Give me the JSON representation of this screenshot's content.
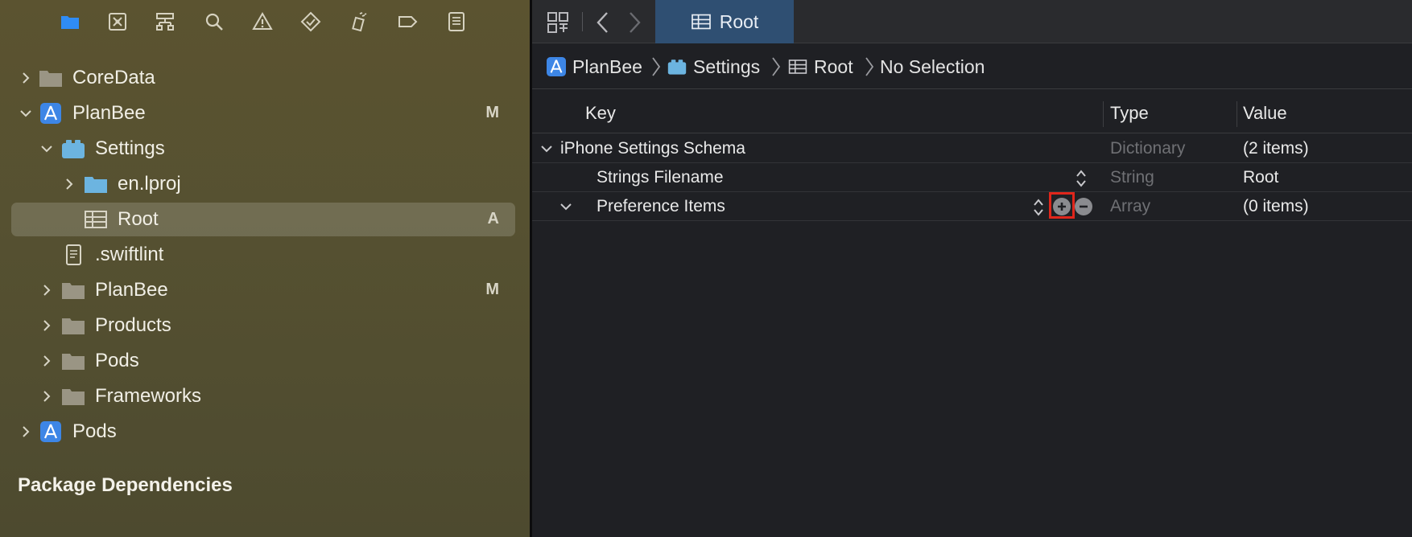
{
  "navigator": {
    "toolbar_icons": [
      "folder-icon",
      "source-control-icon",
      "hierarchy-icon",
      "search-icon",
      "warning-icon",
      "test-icon",
      "debug-icon",
      "breakpoint-icon",
      "report-icon"
    ],
    "tree": [
      {
        "label": "CoreData",
        "icon": "folder-icon",
        "expanded": false,
        "badge": ""
      },
      {
        "label": "PlanBee",
        "icon": "xcode-project-icon",
        "expanded": true,
        "badge": "M"
      },
      {
        "label": "Settings",
        "icon": "bundle-icon",
        "expanded": true,
        "badge": ""
      },
      {
        "label": "en.lproj",
        "icon": "folder-blue-icon",
        "expanded": false,
        "badge": ""
      },
      {
        "label": "Root",
        "icon": "plist-icon",
        "expanded": null,
        "badge": "A",
        "selected": true
      },
      {
        "label": ".swiftlint",
        "icon": "document-icon",
        "expanded": null,
        "badge": ""
      },
      {
        "label": "PlanBee",
        "icon": "folder-icon",
        "expanded": false,
        "badge": "M"
      },
      {
        "label": "Products",
        "icon": "folder-icon",
        "expanded": false,
        "badge": ""
      },
      {
        "label": "Pods",
        "icon": "folder-icon",
        "expanded": false,
        "badge": ""
      },
      {
        "label": "Frameworks",
        "icon": "folder-icon",
        "expanded": false,
        "badge": ""
      },
      {
        "label": "Pods",
        "icon": "xcode-project-icon",
        "expanded": false,
        "badge": ""
      }
    ],
    "section_title": "Package Dependencies"
  },
  "editor": {
    "tab_label": "Root",
    "breadcrumb": [
      "PlanBee",
      "Settings",
      "Root",
      "No Selection"
    ],
    "columns": {
      "key": "Key",
      "type": "Type",
      "value": "Value"
    },
    "rows": [
      {
        "key": "iPhone Settings Schema",
        "type": "Dictionary",
        "value": "(2 items)"
      },
      {
        "key": "Strings Filename",
        "type": "String",
        "value": "Root"
      },
      {
        "key": "Preference Items",
        "type": "Array",
        "value": "(0 items)"
      }
    ]
  },
  "colors": {
    "accent": "#2f4f72",
    "highlight": "#e0261b",
    "sidebar": "#565131"
  }
}
